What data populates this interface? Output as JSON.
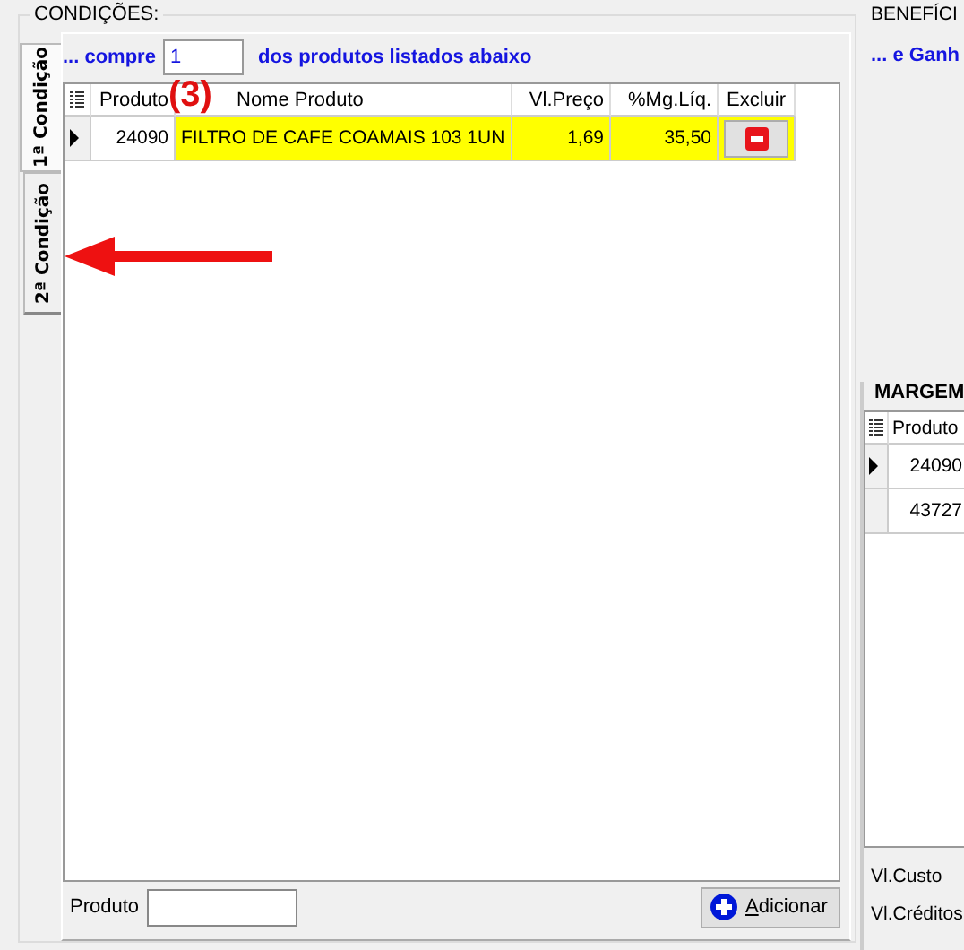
{
  "conditions": {
    "title": "CONDIÇÕES:",
    "tabs": [
      {
        "label": "1ª Condição",
        "selected": true
      },
      {
        "label": "2ª Condição",
        "selected": false
      }
    ],
    "prefix": "... compre",
    "quantity": "1",
    "suffix": "dos produtos listados abaixo",
    "table": {
      "columns": [
        "Produto",
        "Nome Produto",
        "Vl.Preço",
        "%Mg.Líq.",
        "Excluir"
      ],
      "rows": [
        {
          "selected": true,
          "highlighted": true,
          "cells": [
            "24090",
            "FILTRO DE CAFE COAMAIS 103 1UN",
            "1,69",
            "35,50"
          ]
        }
      ]
    },
    "product_label": "Produto",
    "add_button": "Adicionar"
  },
  "annotation": {
    "label": "(3)"
  },
  "benefits": {
    "title": "BENEFÍCI",
    "text": "... e Ganh",
    "margin_title": "MARGEM",
    "table": {
      "columns": [
        "Produto"
      ],
      "rows": [
        {
          "selected": true,
          "cells": [
            "24090"
          ]
        },
        {
          "selected": false,
          "cells": [
            "43727"
          ]
        }
      ]
    },
    "labels": [
      "Vl.Custo",
      "Vl.Créditos"
    ]
  }
}
